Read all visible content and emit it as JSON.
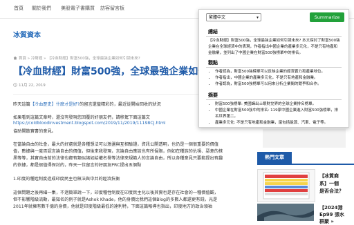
{
  "topnav": {
    "items": [
      "首頁",
      "關於我們",
      "美股電子書購買",
      "訪客留言板"
    ]
  },
  "site": {
    "title": "冰質資本"
  },
  "breadcrumb": "首頁 » 冷財經 » 【冷血財經】財富500強，全球最強企業如何引領未來?",
  "post": {
    "title": "【冷血財經】財富500強，全球最強企業如何引",
    "date": "11月 22, 2019"
  },
  "body": {
    "line1_pre": "昨天這篇",
    "line1_link": "【冷血歷史】什麼才是好?",
    "line1_post": "的留言還蠻精彩的，最近從開始回收的狀況",
    "line2": "如果看到這篇文章時，還沒有發現您回覆的好朋友們，請移駕下面這篇文",
    "line3_link": "https://coldbloodinvestment.blogspot.com/2019/11/2019/11198CJ.html",
    "line4": "協助開散實書的意見。",
    "line5": "在當論自由的社會，最大的好處就是各種想法可以激盪與互相驗證，資訊公開透明，也仍是一個很重要的價值",
    "line6": "值，數據與一度否認言論自由的價值，但後來我發現，言論自由應該也有所侷限，例如在種族的仇視、惡意的抹",
    "line7": "黑等等，其實自由前的法律也都有類似諸如給權名譽等法律來規範人的言論自由，所以各種意見只要能提出有趣",
    "line8": "的依據，都是很值得探討的，昨天一位留言的好朋友PRC提出五個點",
    "line9": "1.印度的種姓制度造成印度民主也無法與中共的經濟抗衡",
    "line10": "這個問題之後再細一集，不過簡單說一下，印度種性制度在印度民主化以後其實也是存在社會的一種價值觀，",
    "line11": "但不影響階級流動，最知名的例子就是Ashok Khade，他的身價比我們這個Blog的多數人都還更有錢，光是",
    "line12": "2011年就擁有數千億的身價，他就是印度階級最低的達利特，下面這篇報導也指出，印度地方的政治領袖"
  },
  "popup": {
    "language": "繁體中文",
    "summarize_label": "Summarize",
    "sections": {
      "summary": {
        "title": "總結",
        "text": "【冷血財經】財富500強，全球最強企業如何引領未來? 本文探討了財富500強企業在全球經濟中的表現，作者指出中國企業的產業多元化，不是只有地產和金融業，並列出了中國企業在財富500強榜單中的排名。"
      },
      "viewpoints": {
        "title": "觀點",
        "items": [
          "作者認為，財富500強榜單可以反映企業的經濟實力和產業地位。",
          "作者指出，中國企業的產業多元化，不是只有地產和金融業。",
          "作者認為，財富500強榜單可以用來分析企業間的競爭和合作。"
        ]
      },
      "abstract": {
        "title": "摘要",
        "items": [
          "財富500強榜單: 美國蟬出士眼財兌界的全球企業排名榜單。",
          "中國企業在財富500強中的排名: 119家中國企業進入財富500強榜單，排名世界第二。",
          "產業多元化: 不是只有地產和金融業，還包括能源、汽車、電子等。"
        ]
      }
    }
  },
  "sidebar": {
    "hot_label": "熱門文章",
    "article1": [
      "【冰質商",
      "系】一個",
      "是否合法？"
    ],
    "article2": [
      "【2024港",
      "Ep99 張水",
      "群聚 »"
    ]
  }
}
